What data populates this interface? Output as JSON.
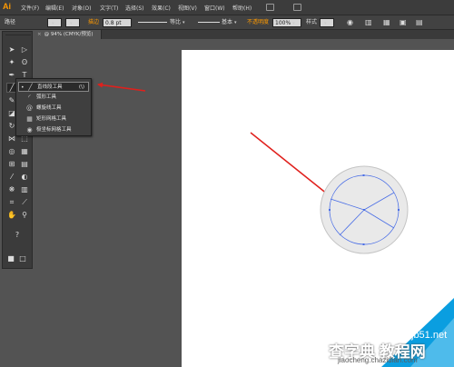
{
  "app": {
    "logo": "Ai"
  },
  "menubar": {
    "items": [
      "文件(F)",
      "编辑(E)",
      "对象(O)",
      "文字(T)",
      "选择(S)",
      "效果(C)",
      "视图(V)",
      "窗口(W)",
      "帮助(H)"
    ]
  },
  "controlbar": {
    "selection_label": "路径",
    "stroke_label": "描边",
    "stroke_value": "0.8 pt",
    "profile_label": "等比",
    "brush_label": "基本",
    "opacity_label": "不透明度",
    "opacity_value": "100%",
    "style_label": "样式"
  },
  "document": {
    "tab_title": "@ 94% (CMYK/预览)",
    "close_glyph": "×"
  },
  "tools": [
    {
      "name": "selection-tool-icon",
      "glyph": "➤"
    },
    {
      "name": "direct-selection-tool-icon",
      "glyph": "▷"
    },
    {
      "name": "magic-wand-tool-icon",
      "glyph": "✦"
    },
    {
      "name": "lasso-tool-icon",
      "glyph": "ʘ"
    },
    {
      "name": "pen-tool-icon",
      "glyph": "✒"
    },
    {
      "name": "type-tool-icon",
      "glyph": "T"
    },
    {
      "name": "line-segment-tool-icon",
      "glyph": "╱"
    },
    {
      "name": "rectangle-tool-icon",
      "glyph": "▭"
    },
    {
      "name": "paintbrush-tool-icon",
      "glyph": "✎"
    },
    {
      "name": "pencil-tool-icon",
      "glyph": "✏"
    },
    {
      "name": "blob-brush-tool-icon",
      "glyph": "◪"
    },
    {
      "name": "eraser-tool-icon",
      "glyph": "◫"
    },
    {
      "name": "rotate-tool-icon",
      "glyph": "↻"
    },
    {
      "name": "scale-tool-icon",
      "glyph": "⤢"
    },
    {
      "name": "width-tool-icon",
      "glyph": "⋈"
    },
    {
      "name": "free-transform-tool-icon",
      "glyph": "⬚"
    },
    {
      "name": "shape-builder-tool-icon",
      "glyph": "◎"
    },
    {
      "name": "perspective-grid-tool-icon",
      "glyph": "▦"
    },
    {
      "name": "mesh-tool-icon",
      "glyph": "⊞"
    },
    {
      "name": "gradient-tool-icon",
      "glyph": "▤"
    },
    {
      "name": "eyedropper-tool-icon",
      "glyph": "⁄"
    },
    {
      "name": "blend-tool-icon",
      "glyph": "◐"
    },
    {
      "name": "symbol-sprayer-tool-icon",
      "glyph": "❋"
    },
    {
      "name": "column-graph-tool-icon",
      "glyph": "▥"
    },
    {
      "name": "artboard-tool-icon",
      "glyph": "⌗"
    },
    {
      "name": "slice-tool-icon",
      "glyph": "⟋"
    },
    {
      "name": "hand-tool-icon",
      "glyph": "✋"
    },
    {
      "name": "zoom-tool-icon",
      "glyph": "⚲"
    }
  ],
  "flyout": {
    "items": [
      {
        "label": "直线段工具",
        "shortcut": "(\\)",
        "glyph": "╱",
        "checked": "•"
      },
      {
        "label": "弧形工具",
        "shortcut": "",
        "glyph": "◜",
        "checked": ""
      },
      {
        "label": "螺旋线工具",
        "shortcut": "",
        "glyph": "@",
        "checked": ""
      },
      {
        "label": "矩形网格工具",
        "shortcut": "",
        "glyph": "▦",
        "checked": ""
      },
      {
        "label": "极坐标网格工具",
        "shortcut": "",
        "glyph": "◉",
        "checked": ""
      }
    ]
  },
  "colors": {
    "arrow": "#e0201c",
    "path": "#4a6ee6",
    "circle_outer": "#e9e9e9",
    "watermark_blue": "#0a9ee0"
  },
  "watermark": {
    "line1": "jb51.net",
    "line2": "查字典 教程网",
    "line3": "jiaocheng.chazidian.com"
  }
}
